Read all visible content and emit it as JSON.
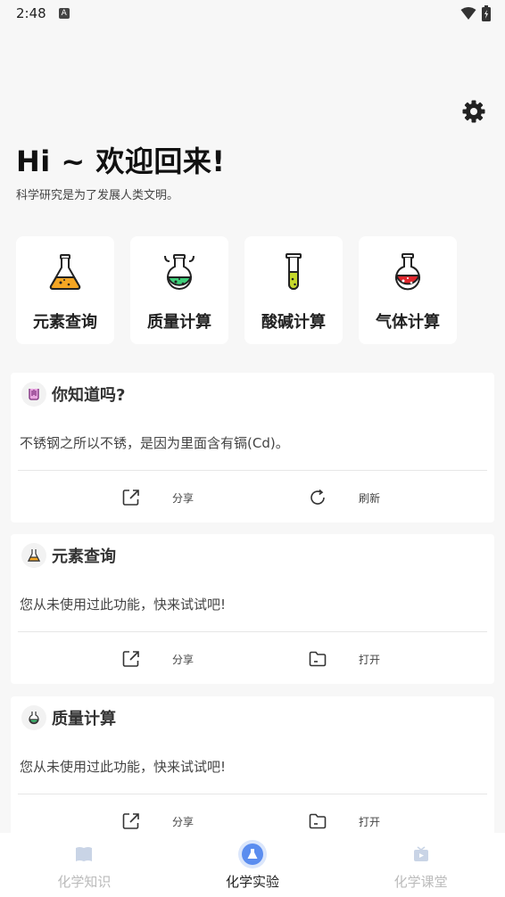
{
  "status_bar": {
    "time": "2:48",
    "a_badge": "A"
  },
  "header": {
    "greeting": "Hi ~ 欢迎回来!",
    "subtitle": "科学研究是为了发展人类文明。"
  },
  "quick_tools": [
    {
      "label": "元素查询",
      "icon": "orange-flask-icon"
    },
    {
      "label": "质量计算",
      "icon": "green-round-flask-icon"
    },
    {
      "label": "酸碱计算",
      "icon": "test-tube-icon"
    },
    {
      "label": "气体计算",
      "icon": "red-flask-icon"
    }
  ],
  "cards": [
    {
      "title": "你知道吗?",
      "body": "不锈钢之所以不锈，是因为里面含有镉(Cd)。",
      "action1": "分享",
      "action2": "刷新"
    },
    {
      "title": "元素查询",
      "body": "您从未使用过此功能，快来试试吧!",
      "action1": "分享",
      "action2": "打开"
    },
    {
      "title": "质量计算",
      "body": "您从未使用过此功能，快来试试吧!",
      "action1": "分享",
      "action2": "打开"
    }
  ],
  "tabs": [
    {
      "label": "化学知识",
      "active": false
    },
    {
      "label": "化学实验",
      "active": true
    },
    {
      "label": "化学课堂",
      "active": false
    }
  ],
  "colors": {
    "accent": "#5b8def",
    "orange": "#f5a623",
    "green": "#3ecf7a",
    "red": "#e0262c",
    "yellowgreen": "#c6d92b"
  }
}
